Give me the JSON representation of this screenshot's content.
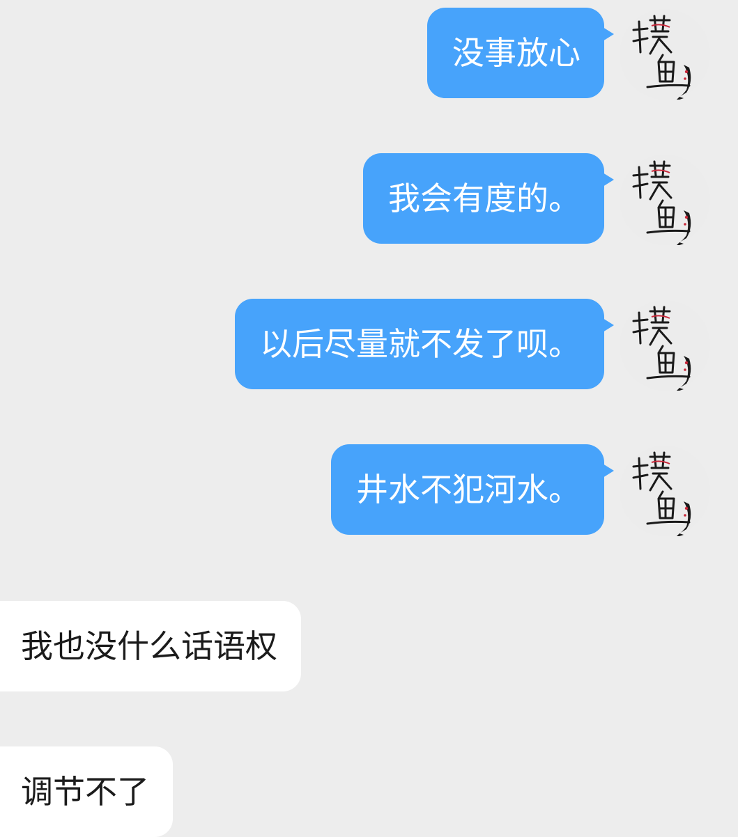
{
  "conversation": {
    "messages": [
      {
        "direction": "outgoing",
        "text": "没事放心"
      },
      {
        "direction": "outgoing",
        "text": "我会有度的。"
      },
      {
        "direction": "outgoing",
        "text": "以后尽量就不发了呗。"
      },
      {
        "direction": "outgoing",
        "text": "井水不犯河水。"
      },
      {
        "direction": "incoming",
        "text": "我也没什么话语权"
      },
      {
        "direction": "incoming",
        "text": "调节不了"
      }
    ],
    "self_avatar": {
      "icon": "calligraphy-fish-avatar-icon"
    }
  },
  "colors": {
    "background": "#ededed",
    "outgoing_bubble": "#47a3fb",
    "incoming_bubble": "#ffffff"
  }
}
